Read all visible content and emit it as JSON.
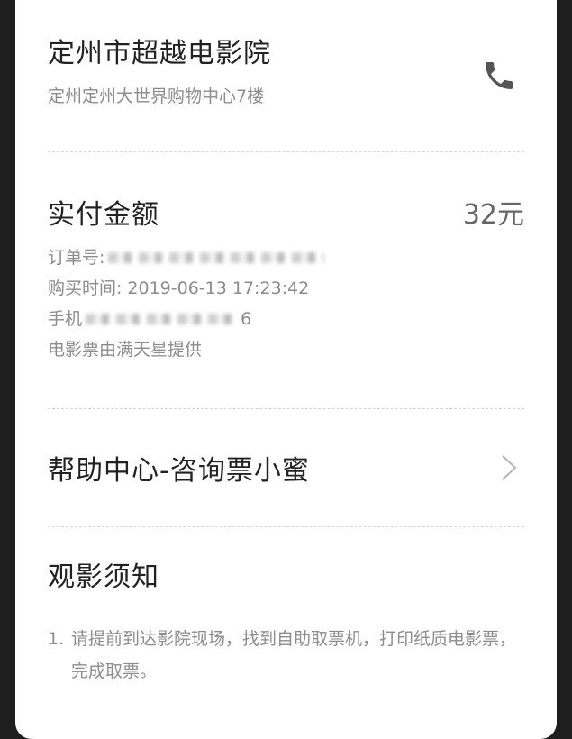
{
  "cinema": {
    "name": "定州市超越电影院",
    "address": "定州定州大世界购物中心7楼"
  },
  "payment": {
    "label": "实付金额",
    "amount": "32元"
  },
  "order": {
    "order_no_label": "订单号:",
    "purchase_time_label": "购买时间:",
    "purchase_time": "2019-06-13 17:23:42",
    "phone_label": "手机",
    "phone_suffix": "6",
    "provider_text": "电影票由满天星提供"
  },
  "help": {
    "label": "帮助中心-咨询票小蜜"
  },
  "notice": {
    "title": "观影须知",
    "items": [
      {
        "num": "1.",
        "text": "请提前到达影院现场，找到自助取票机，打印纸质电影票，完成取票。"
      }
    ]
  },
  "icons": {
    "phone": "phone-icon",
    "chevron": "chevron-right-icon"
  },
  "colors": {
    "primary_text": "#222222",
    "secondary_text": "#8c8c8c",
    "card_bg": "#ffffff",
    "backdrop": "#1e1e1e"
  }
}
